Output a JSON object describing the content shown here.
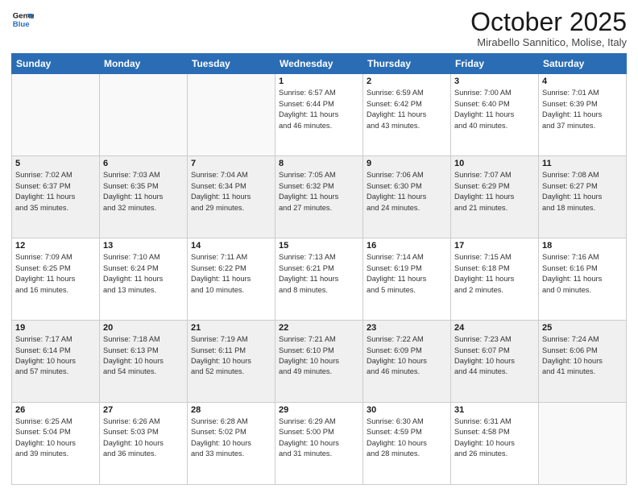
{
  "logo": {
    "line1": "General",
    "line2": "Blue"
  },
  "header": {
    "month": "October 2025",
    "location": "Mirabello Sannitico, Molise, Italy"
  },
  "weekdays": [
    "Sunday",
    "Monday",
    "Tuesday",
    "Wednesday",
    "Thursday",
    "Friday",
    "Saturday"
  ],
  "weeks": [
    [
      {
        "day": "",
        "info": ""
      },
      {
        "day": "",
        "info": ""
      },
      {
        "day": "",
        "info": ""
      },
      {
        "day": "1",
        "info": "Sunrise: 6:57 AM\nSunset: 6:44 PM\nDaylight: 11 hours\nand 46 minutes."
      },
      {
        "day": "2",
        "info": "Sunrise: 6:59 AM\nSunset: 6:42 PM\nDaylight: 11 hours\nand 43 minutes."
      },
      {
        "day": "3",
        "info": "Sunrise: 7:00 AM\nSunset: 6:40 PM\nDaylight: 11 hours\nand 40 minutes."
      },
      {
        "day": "4",
        "info": "Sunrise: 7:01 AM\nSunset: 6:39 PM\nDaylight: 11 hours\nand 37 minutes."
      }
    ],
    [
      {
        "day": "5",
        "info": "Sunrise: 7:02 AM\nSunset: 6:37 PM\nDaylight: 11 hours\nand 35 minutes."
      },
      {
        "day": "6",
        "info": "Sunrise: 7:03 AM\nSunset: 6:35 PM\nDaylight: 11 hours\nand 32 minutes."
      },
      {
        "day": "7",
        "info": "Sunrise: 7:04 AM\nSunset: 6:34 PM\nDaylight: 11 hours\nand 29 minutes."
      },
      {
        "day": "8",
        "info": "Sunrise: 7:05 AM\nSunset: 6:32 PM\nDaylight: 11 hours\nand 27 minutes."
      },
      {
        "day": "9",
        "info": "Sunrise: 7:06 AM\nSunset: 6:30 PM\nDaylight: 11 hours\nand 24 minutes."
      },
      {
        "day": "10",
        "info": "Sunrise: 7:07 AM\nSunset: 6:29 PM\nDaylight: 11 hours\nand 21 minutes."
      },
      {
        "day": "11",
        "info": "Sunrise: 7:08 AM\nSunset: 6:27 PM\nDaylight: 11 hours\nand 18 minutes."
      }
    ],
    [
      {
        "day": "12",
        "info": "Sunrise: 7:09 AM\nSunset: 6:25 PM\nDaylight: 11 hours\nand 16 minutes."
      },
      {
        "day": "13",
        "info": "Sunrise: 7:10 AM\nSunset: 6:24 PM\nDaylight: 11 hours\nand 13 minutes."
      },
      {
        "day": "14",
        "info": "Sunrise: 7:11 AM\nSunset: 6:22 PM\nDaylight: 11 hours\nand 10 minutes."
      },
      {
        "day": "15",
        "info": "Sunrise: 7:13 AM\nSunset: 6:21 PM\nDaylight: 11 hours\nand 8 minutes."
      },
      {
        "day": "16",
        "info": "Sunrise: 7:14 AM\nSunset: 6:19 PM\nDaylight: 11 hours\nand 5 minutes."
      },
      {
        "day": "17",
        "info": "Sunrise: 7:15 AM\nSunset: 6:18 PM\nDaylight: 11 hours\nand 2 minutes."
      },
      {
        "day": "18",
        "info": "Sunrise: 7:16 AM\nSunset: 6:16 PM\nDaylight: 11 hours\nand 0 minutes."
      }
    ],
    [
      {
        "day": "19",
        "info": "Sunrise: 7:17 AM\nSunset: 6:14 PM\nDaylight: 10 hours\nand 57 minutes."
      },
      {
        "day": "20",
        "info": "Sunrise: 7:18 AM\nSunset: 6:13 PM\nDaylight: 10 hours\nand 54 minutes."
      },
      {
        "day": "21",
        "info": "Sunrise: 7:19 AM\nSunset: 6:11 PM\nDaylight: 10 hours\nand 52 minutes."
      },
      {
        "day": "22",
        "info": "Sunrise: 7:21 AM\nSunset: 6:10 PM\nDaylight: 10 hours\nand 49 minutes."
      },
      {
        "day": "23",
        "info": "Sunrise: 7:22 AM\nSunset: 6:09 PM\nDaylight: 10 hours\nand 46 minutes."
      },
      {
        "day": "24",
        "info": "Sunrise: 7:23 AM\nSunset: 6:07 PM\nDaylight: 10 hours\nand 44 minutes."
      },
      {
        "day": "25",
        "info": "Sunrise: 7:24 AM\nSunset: 6:06 PM\nDaylight: 10 hours\nand 41 minutes."
      }
    ],
    [
      {
        "day": "26",
        "info": "Sunrise: 6:25 AM\nSunset: 5:04 PM\nDaylight: 10 hours\nand 39 minutes."
      },
      {
        "day": "27",
        "info": "Sunrise: 6:26 AM\nSunset: 5:03 PM\nDaylight: 10 hours\nand 36 minutes."
      },
      {
        "day": "28",
        "info": "Sunrise: 6:28 AM\nSunset: 5:02 PM\nDaylight: 10 hours\nand 33 minutes."
      },
      {
        "day": "29",
        "info": "Sunrise: 6:29 AM\nSunset: 5:00 PM\nDaylight: 10 hours\nand 31 minutes."
      },
      {
        "day": "30",
        "info": "Sunrise: 6:30 AM\nSunset: 4:59 PM\nDaylight: 10 hours\nand 28 minutes."
      },
      {
        "day": "31",
        "info": "Sunrise: 6:31 AM\nSunset: 4:58 PM\nDaylight: 10 hours\nand 26 minutes."
      },
      {
        "day": "",
        "info": ""
      }
    ]
  ],
  "row_styles": [
    "white",
    "shaded",
    "white",
    "shaded",
    "white"
  ]
}
